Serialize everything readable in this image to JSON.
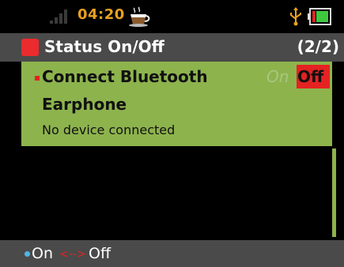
{
  "status_bar": {
    "time": "04:20",
    "icons": [
      "signal-icon",
      "coffee-cup-icon",
      "usb-icon",
      "battery-icon"
    ]
  },
  "title_bar": {
    "title": "Status On/Off",
    "page": "(2/2)"
  },
  "setting": {
    "label": "Connect Bluetooth",
    "on_label": "On",
    "off_label": "Off",
    "selected": "Off",
    "device_name": "Earphone",
    "device_status": "No device connected"
  },
  "footer": {
    "on_label": "On",
    "arrow": "<-->",
    "off_label": "Off"
  },
  "colors": {
    "accent_green": "#8db34d",
    "red": "#e52222",
    "clock_orange": "#e8a020",
    "bar_gray": "#4a4a4a",
    "dot_blue": "#4fb5e6"
  }
}
